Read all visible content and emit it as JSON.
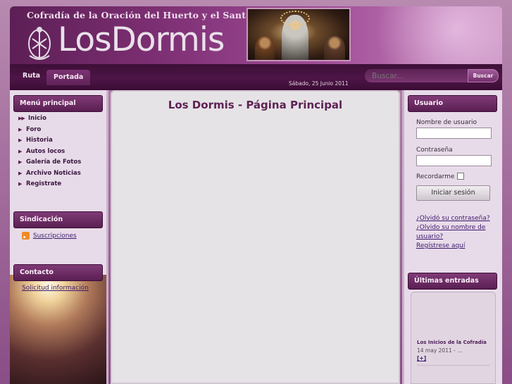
{
  "header": {
    "motto": "Cofradía de la Oración del Huerto y el Santo Sepulcro",
    "logo_text": "LosDormis"
  },
  "nav": {
    "tabs": [
      {
        "label": "Ruta"
      },
      {
        "label": "Portada"
      }
    ],
    "date": "Sábado, 25 Junio 2011",
    "search_placeholder": "Buscar...",
    "search_button": "Buscar"
  },
  "left": {
    "main_menu_title": "Menú principal",
    "menu_items": [
      {
        "label": "Inicio"
      },
      {
        "label": "Foro"
      },
      {
        "label": "Historia"
      },
      {
        "label": "Autos locos"
      },
      {
        "label": "Galería de Fotos"
      },
      {
        "label": "Archivo Noticias"
      },
      {
        "label": "Registrate"
      }
    ],
    "syndication_title": "Sindicación",
    "subscriptions_link": "Suscripciones",
    "contact_title": "Contacto",
    "contact_link": "Solicitud información"
  },
  "main": {
    "heading": "Los Dormis - Página Principal"
  },
  "right": {
    "user_title": "Usuario",
    "username_label": "Nombre de usuario",
    "password_label": "Contraseña",
    "remember_label": "Recordarme",
    "login_button": "Iniciar sesión",
    "forgot_password": "¿Olvidó su contraseña?",
    "forgot_username": "¿Olvido su nombre de usuario?",
    "register": "Regístrese aquí",
    "latest_title": "Últimas entradas",
    "latest": {
      "title": "Los Inicios de la Cofradía",
      "meta": "14 may 2011 - ...",
      "more": "[+]"
    }
  },
  "colors": {
    "brand_purple": "#5a1f53",
    "header_gradient_end": "#c98fc0",
    "link": "#3d1a6d",
    "main_background": "#e6e3e6"
  }
}
